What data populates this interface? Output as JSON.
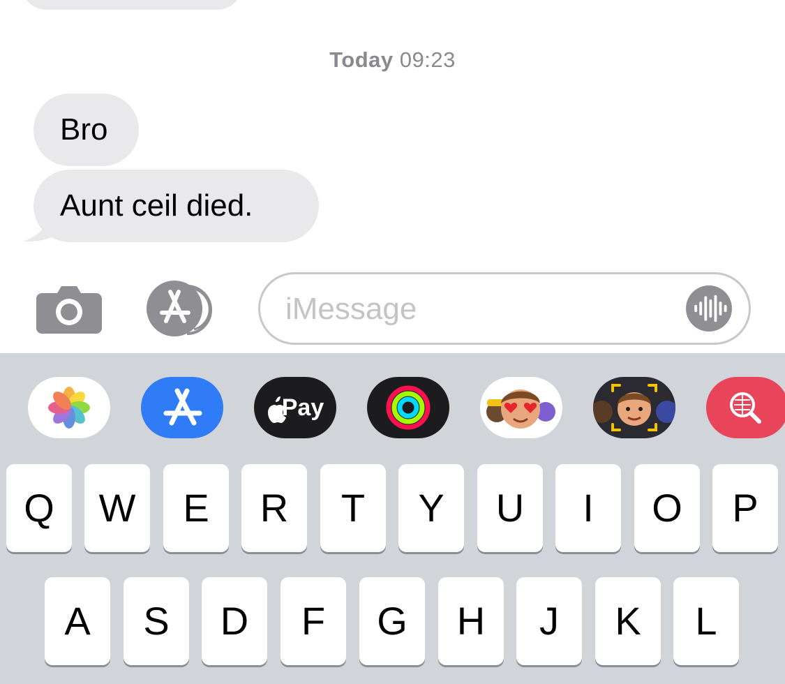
{
  "conversation": {
    "timestamp_day": "Today",
    "timestamp_time": "09:23",
    "messages": [
      {
        "text": "Bro",
        "direction": "incoming"
      },
      {
        "text": "Aunt ceil died.",
        "direction": "incoming"
      }
    ]
  },
  "input_bar": {
    "camera_icon": "camera-icon",
    "apps_icon": "app-store-icon",
    "message_placeholder": "iMessage",
    "message_value": "",
    "audio_icon": "audio-waveform-icon"
  },
  "app_drawer": {
    "items": [
      {
        "name": "photos",
        "icon": "photos-icon"
      },
      {
        "name": "app-store",
        "icon": "app-store-icon"
      },
      {
        "name": "apple-pay",
        "label": "Pay",
        "icon": "apple-logo-icon"
      },
      {
        "name": "activity",
        "icon": "activity-rings-icon"
      },
      {
        "name": "memoji-stickers",
        "icon": "memoji-stickers-icon"
      },
      {
        "name": "memoji",
        "icon": "memoji-icon"
      },
      {
        "name": "images-search",
        "icon": "search-globe-icon"
      }
    ]
  },
  "keyboard": {
    "row1": [
      "Q",
      "W",
      "E",
      "R",
      "T",
      "Y",
      "U",
      "I",
      "O",
      "P"
    ],
    "row2": [
      "A",
      "S",
      "D",
      "F",
      "G",
      "H",
      "J",
      "K",
      "L"
    ]
  },
  "colors": {
    "bubble_incoming": "#e9e9eb",
    "keyboard_bg": "#d1d4d9",
    "app_store_blue": "#2f7cf6",
    "search_red": "#e9455a",
    "icon_gray": "#8e8e93"
  }
}
